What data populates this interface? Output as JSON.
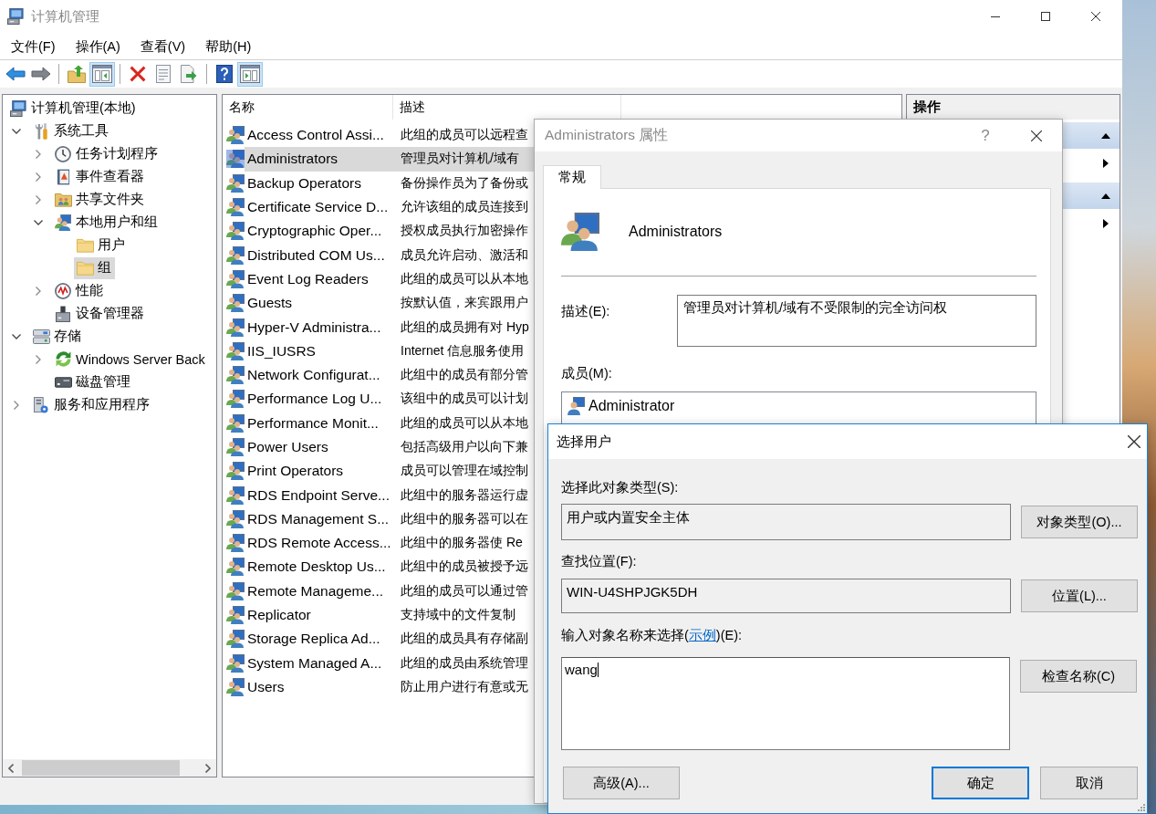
{
  "window": {
    "title": "计算机管理",
    "active": false
  },
  "menu": [
    {
      "label": "文件(F)"
    },
    {
      "label": "操作(A)"
    },
    {
      "label": "查看(V)"
    },
    {
      "label": "帮助(H)"
    }
  ],
  "toolbar": [
    {
      "kind": "back",
      "pressed": false
    },
    {
      "kind": "forward",
      "pressed": false
    },
    {
      "kind": "separator"
    },
    {
      "kind": "up",
      "pressed": false
    },
    {
      "kind": "tree",
      "pressed": true
    },
    {
      "kind": "separator"
    },
    {
      "kind": "delete",
      "pressed": false
    },
    {
      "kind": "properties",
      "pressed": false
    },
    {
      "kind": "export",
      "pressed": false
    },
    {
      "kind": "separator"
    },
    {
      "kind": "help",
      "pressed": false
    },
    {
      "kind": "actions",
      "pressed": true
    }
  ],
  "tree": {
    "label": "计算机管理(本地)",
    "kind": "computer",
    "selected": false,
    "children": [
      {
        "label": "系统工具",
        "kind": "tools",
        "expanded": true,
        "selected": false,
        "children": [
          {
            "label": "任务计划程序",
            "kind": "scheduler",
            "expanded": false,
            "selected": false
          },
          {
            "label": "事件查看器",
            "kind": "events",
            "expanded": false,
            "selected": false
          },
          {
            "label": "共享文件夹",
            "kind": "shares",
            "expanded": false,
            "selected": false
          },
          {
            "label": "本地用户和组",
            "kind": "users",
            "expanded": true,
            "selected": false,
            "children": [
              {
                "label": "用户",
                "kind": "folder",
                "selected": false
              },
              {
                "label": "组",
                "kind": "folder",
                "selected": true
              }
            ]
          },
          {
            "label": "性能",
            "kind": "performance",
            "expanded": false,
            "selected": false
          },
          {
            "label": "设备管理器",
            "kind": "devices",
            "selected": false
          }
        ]
      },
      {
        "label": "存储",
        "kind": "storage",
        "expanded": true,
        "selected": false,
        "children": [
          {
            "label": "Windows Server Back",
            "kind": "backup",
            "expanded": false,
            "selected": false
          },
          {
            "label": "磁盘管理",
            "kind": "disk",
            "selected": false
          }
        ]
      },
      {
        "label": "服务和应用程序",
        "kind": "services",
        "expanded": false,
        "selected": false
      }
    ]
  },
  "list": {
    "columns": [
      "名称",
      "描述"
    ],
    "rows": [
      {
        "name": "Access Control Assi...",
        "description": "此组的成员可以远程查",
        "selected": false
      },
      {
        "name": "Administrators",
        "description": "管理员对计算机/域有",
        "selected": true
      },
      {
        "name": "Backup Operators",
        "description": "备份操作员为了备份或",
        "selected": false
      },
      {
        "name": "Certificate Service D...",
        "description": "允许该组的成员连接到",
        "selected": false
      },
      {
        "name": "Cryptographic Oper...",
        "description": "授权成员执行加密操作",
        "selected": false
      },
      {
        "name": "Distributed COM Us...",
        "description": "成员允许启动、激活和",
        "selected": false
      },
      {
        "name": "Event Log Readers",
        "description": "此组的成员可以从本地",
        "selected": false
      },
      {
        "name": "Guests",
        "description": "按默认值，来宾跟用户",
        "selected": false
      },
      {
        "name": "Hyper-V Administra...",
        "description": "此组的成员拥有对 Hyp",
        "selected": false
      },
      {
        "name": "IIS_IUSRS",
        "description": "Internet 信息服务使用",
        "selected": false
      },
      {
        "name": "Network Configurat...",
        "description": "此组中的成员有部分管",
        "selected": false
      },
      {
        "name": "Performance Log U...",
        "description": "该组中的成员可以计划",
        "selected": false
      },
      {
        "name": "Performance Monit...",
        "description": "此组的成员可以从本地",
        "selected": false
      },
      {
        "name": "Power Users",
        "description": "包括高级用户以向下兼",
        "selected": false
      },
      {
        "name": "Print Operators",
        "description": "成员可以管理在域控制",
        "selected": false
      },
      {
        "name": "RDS Endpoint Serve...",
        "description": "此组中的服务器运行虚",
        "selected": false
      },
      {
        "name": "RDS Management S...",
        "description": "此组中的服务器可以在",
        "selected": false
      },
      {
        "name": "RDS Remote Access...",
        "description": "此组中的服务器使 Re",
        "selected": false
      },
      {
        "name": "Remote Desktop Us...",
        "description": "此组中的成员被授予远",
        "selected": false
      },
      {
        "name": "Remote Manageme...",
        "description": "此组的成员可以通过管",
        "selected": false
      },
      {
        "name": "Replicator",
        "description": "支持域中的文件复制",
        "selected": false
      },
      {
        "name": "Storage Replica Ad...",
        "description": "此组的成员具有存储副",
        "selected": false
      },
      {
        "name": "System Managed A...",
        "description": "此组的成员由系统管理",
        "selected": false
      },
      {
        "name": "Users",
        "description": "防止用户进行有意或无",
        "selected": false
      }
    ]
  },
  "actions": {
    "title": "操作",
    "sections": [
      {
        "expanded": true,
        "items": [
          {
            "kind": "submenu"
          }
        ]
      },
      {
        "expanded": true,
        "items": [
          {
            "kind": "submenu"
          }
        ]
      }
    ]
  },
  "properties_dialog": {
    "title": "Administrators 属性",
    "active": false,
    "help_button": "?",
    "tabs": [
      {
        "label": "常规",
        "selected": true
      }
    ],
    "group_name": "Administrators",
    "description_label": "描述(E):",
    "description": "管理员对计算机/域有不受限制的完全访问权",
    "members_label": "成员(M):",
    "members": [
      {
        "name": "Administrator"
      }
    ]
  },
  "select_dialog": {
    "title": "选择用户",
    "active": true,
    "object_type_label": "选择此对象类型(S):",
    "object_type": "用户或内置安全主体",
    "object_type_button": "对象类型(O)...",
    "location_label": "查找位置(F):",
    "location": "WIN-U4SHPJGK5DH",
    "location_button": "位置(L)...",
    "names_label": {
      "before": "输入对象名称来选择(",
      "link": "示例",
      "after": ")(E):"
    },
    "names": "wang",
    "check_names_button": "检查名称(C)",
    "buttons": [
      {
        "label": "高级(A)...",
        "default": false
      },
      {
        "label": "确定",
        "default": true
      },
      {
        "label": "取消",
        "default": false
      }
    ]
  }
}
